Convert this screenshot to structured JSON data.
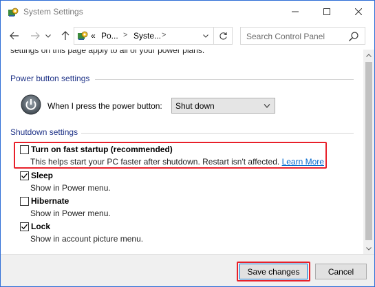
{
  "window": {
    "title": "System Settings",
    "accent": "#2b6cd6",
    "highlight_color": "#e8202a"
  },
  "address_bar": {
    "overflow": "«",
    "crumbs": [
      "Po...",
      "Syste..."
    ],
    "separator": ">"
  },
  "search": {
    "placeholder": "Search Control Panel"
  },
  "content": {
    "intro": "settings on this page apply to all of your power plans.",
    "power_section": {
      "title": "Power button settings",
      "label": "When I press the power button:",
      "selected": "Shut down"
    },
    "shutdown_section": {
      "title": "Shutdown settings",
      "options": [
        {
          "label": "Turn on fast startup (recommended)",
          "desc": "This helps start your PC faster after shutdown. Restart isn't affected.",
          "link": "Learn More",
          "checked": false
        },
        {
          "label": "Sleep",
          "desc": "Show in Power menu.",
          "checked": true
        },
        {
          "label": "Hibernate",
          "desc": "Show in Power menu.",
          "checked": false
        },
        {
          "label": "Lock",
          "desc": "Show in account picture menu.",
          "checked": true
        }
      ]
    }
  },
  "buttons": {
    "save": "Save changes",
    "cancel": "Cancel"
  },
  "icons": [
    "control-panel-icon",
    "minimize-icon",
    "maximize-icon",
    "close-icon",
    "back-arrow-icon",
    "forward-arrow-icon",
    "chevron-down-icon",
    "up-arrow-icon",
    "refresh-icon",
    "search-icon",
    "power-icon",
    "checkmark-icon"
  ]
}
